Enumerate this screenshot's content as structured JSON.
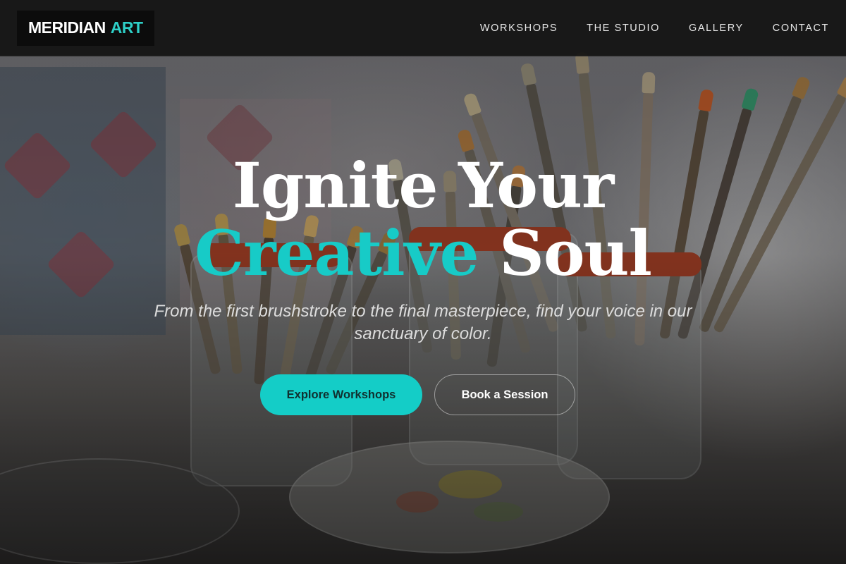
{
  "brand": {
    "name_primary": "MERIDIAN",
    "name_accent": "ART",
    "accent_color": "#17cbc7"
  },
  "nav": {
    "items": [
      {
        "label": "WORKSHOPS"
      },
      {
        "label": "THE STUDIO"
      },
      {
        "label": "GALLERY"
      },
      {
        "label": "CONTACT"
      }
    ]
  },
  "hero": {
    "headline_line1": "Ignite Your",
    "headline_accent": "Creative",
    "headline_line2_rest": "Soul",
    "subtitle": "From the first brushstroke to the final masterpiece, find your voice in our sanctuary of color.",
    "primary_cta": "Explore Workshops",
    "secondary_cta": "Book a Session"
  },
  "colors": {
    "primary_button": "#14cdc7",
    "navbar_bg": "#121212"
  }
}
